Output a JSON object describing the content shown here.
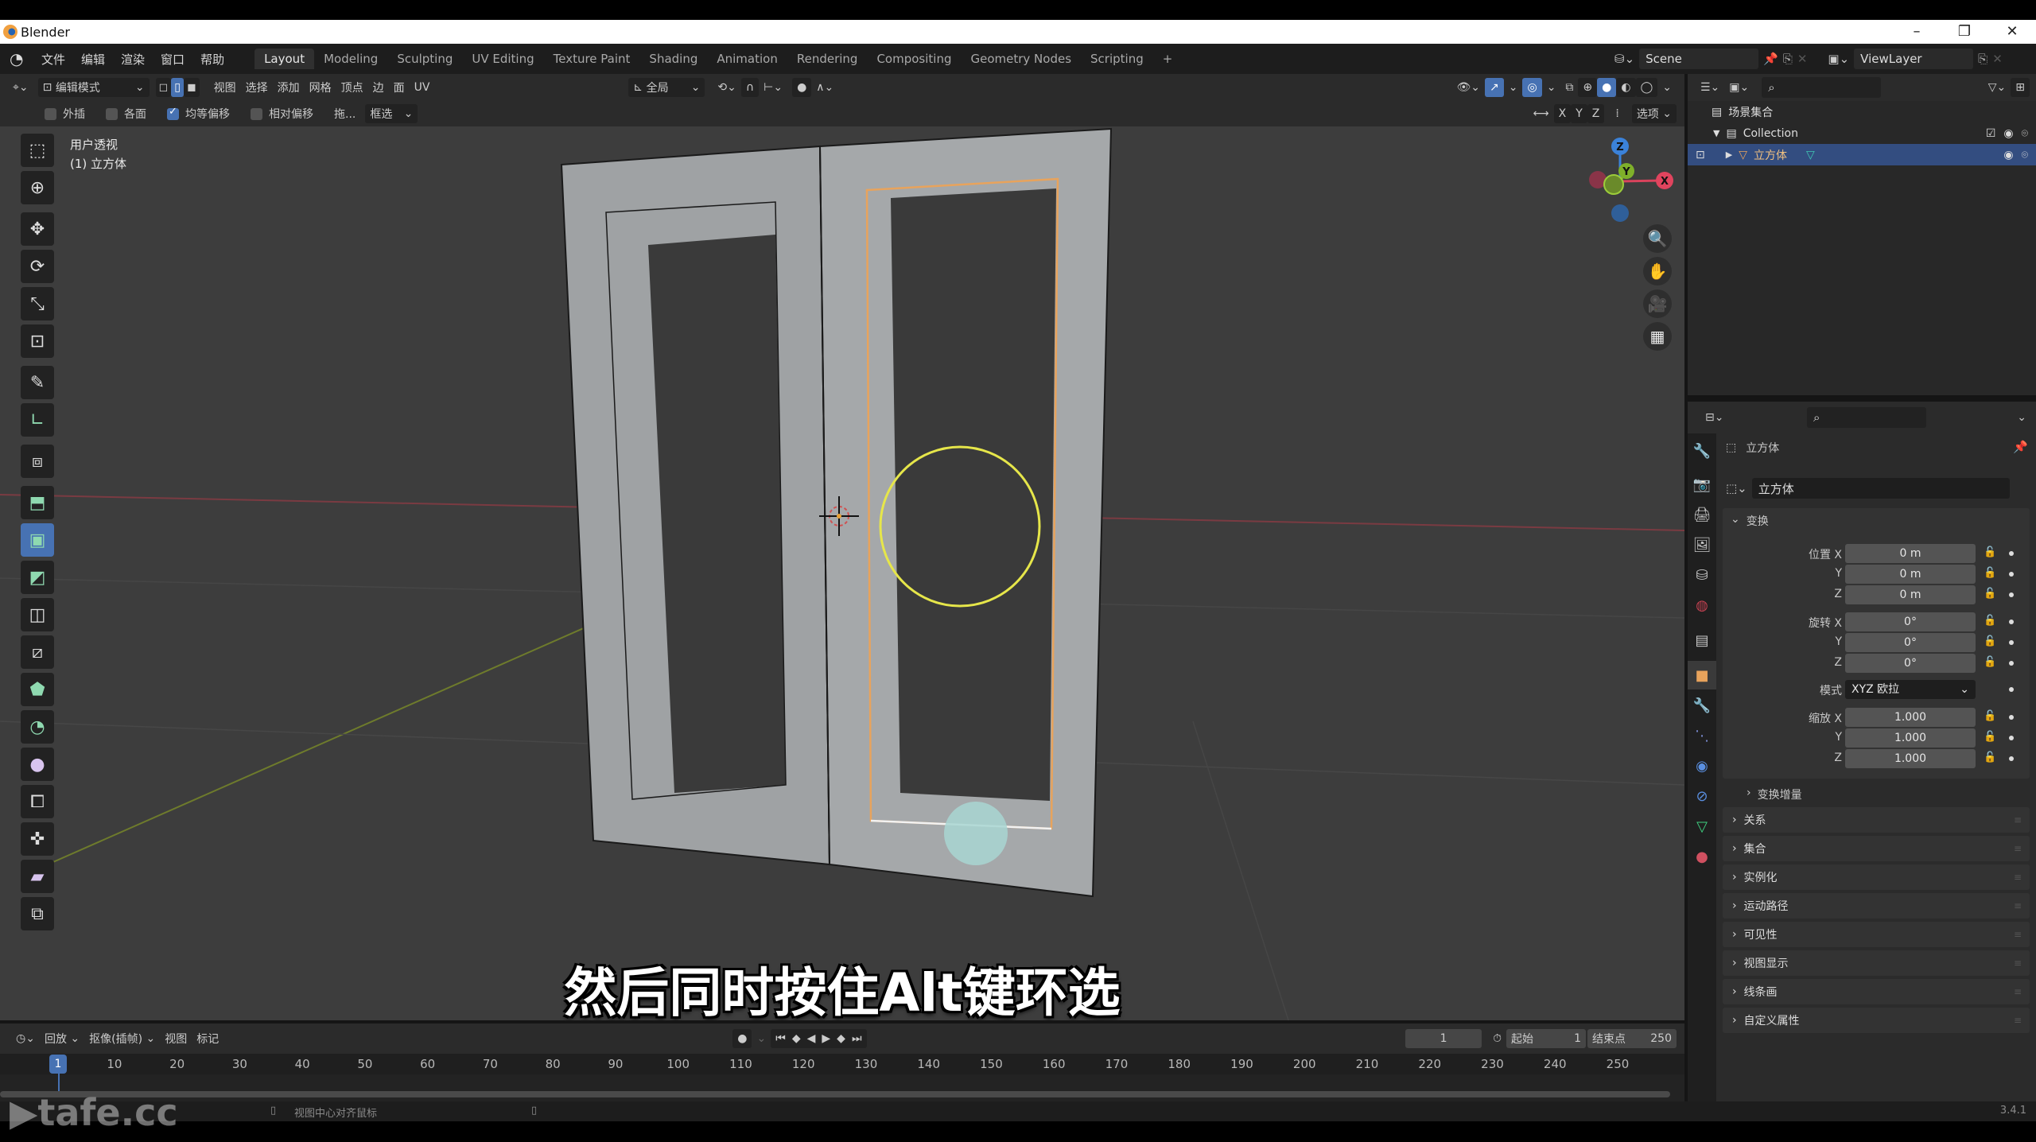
{
  "window": {
    "title": "Blender",
    "controls": [
      "–",
      "❐",
      "✕"
    ]
  },
  "menubar": {
    "menus": [
      "文件",
      "编辑",
      "渲染",
      "窗口",
      "帮助"
    ],
    "workspaces": [
      "Layout",
      "Modeling",
      "Sculpting",
      "UV Editing",
      "Texture Paint",
      "Shading",
      "Animation",
      "Rendering",
      "Compositing",
      "Geometry Nodes",
      "Scripting"
    ],
    "active_workspace": "Layout",
    "add_tab": "+",
    "scene": "Scene",
    "view_layer": "ViewLayer"
  },
  "viewport_header": {
    "mode": "编辑模式",
    "menus": [
      "视图",
      "选择",
      "添加",
      "网格",
      "顶点",
      "边",
      "面",
      "UV"
    ],
    "transform_orientation": "全局",
    "axes": [
      "X",
      "Y",
      "Z"
    ],
    "options_label": "选项"
  },
  "tool_options": {
    "items": [
      {
        "label": "外插",
        "checked": false
      },
      {
        "label": "各面",
        "checked": false
      },
      {
        "label": "均等偏移",
        "checked": true
      },
      {
        "label": "相对偏移",
        "checked": false
      }
    ],
    "drag_label": "拖...",
    "select_mode": "框选"
  },
  "viewport": {
    "view_name": "用户透视",
    "object_info": "(1) 立方体",
    "gizmo_axes": {
      "x": "X",
      "y": "Y",
      "z": "Z"
    },
    "colors": {
      "selection": "#e8a35c",
      "brush_circle": "#e6e64a",
      "x_axis": "#d9435c",
      "y_axis": "#8ab82a",
      "z_axis": "#3b82d9"
    }
  },
  "toolbar": {
    "tools": [
      "select-box",
      "cursor",
      "move",
      "rotate",
      "scale",
      "transform",
      "annotate",
      "measure",
      "add-cube",
      "extrude-region",
      "inset-faces",
      "bevel",
      "loop-cut",
      "knife",
      "poly-build",
      "spin",
      "smooth",
      "edge-slide",
      "shrink-fatten",
      "shear",
      "rip-region"
    ],
    "active_tool": "inset-faces"
  },
  "subtitle": "然后同时按住Alt键环选",
  "outliner": {
    "root": "场景集合",
    "collection": "Collection",
    "object": "立方体"
  },
  "properties": {
    "object_name": "立方体",
    "datablock_name": "立方体",
    "transform_label": "变换",
    "location": {
      "label": "位置",
      "x": "0 m",
      "y": "0 m",
      "z": "0 m"
    },
    "rotation": {
      "label": "旋转",
      "x": "0°",
      "y": "0°",
      "z": "0°"
    },
    "rotation_mode": {
      "label": "模式",
      "value": "XYZ 欧拉"
    },
    "scale": {
      "label": "缩放",
      "x": "1.000",
      "y": "1.000",
      "z": "1.000"
    },
    "delta_transform": "变换增量",
    "sections": [
      "关系",
      "集合",
      "实例化",
      "运动路径",
      "可见性",
      "视图显示",
      "线条画",
      "自定义属性"
    ]
  },
  "timeline": {
    "menus": [
      "回放",
      "抠像(插帧)",
      "视图",
      "标记"
    ],
    "current_frame": "1",
    "start_label": "起始",
    "start": "1",
    "end_label": "结束点",
    "end": "250",
    "ruler_ticks": [
      1,
      10,
      20,
      30,
      40,
      50,
      60,
      70,
      80,
      90,
      100,
      110,
      120,
      130,
      140,
      150,
      160,
      170,
      180,
      190,
      200,
      210,
      220,
      230,
      240,
      250
    ]
  },
  "statusbar": {
    "hint": "视图中心对齐鼠标",
    "version": "3.4.1"
  },
  "watermark": "tafe.cc"
}
